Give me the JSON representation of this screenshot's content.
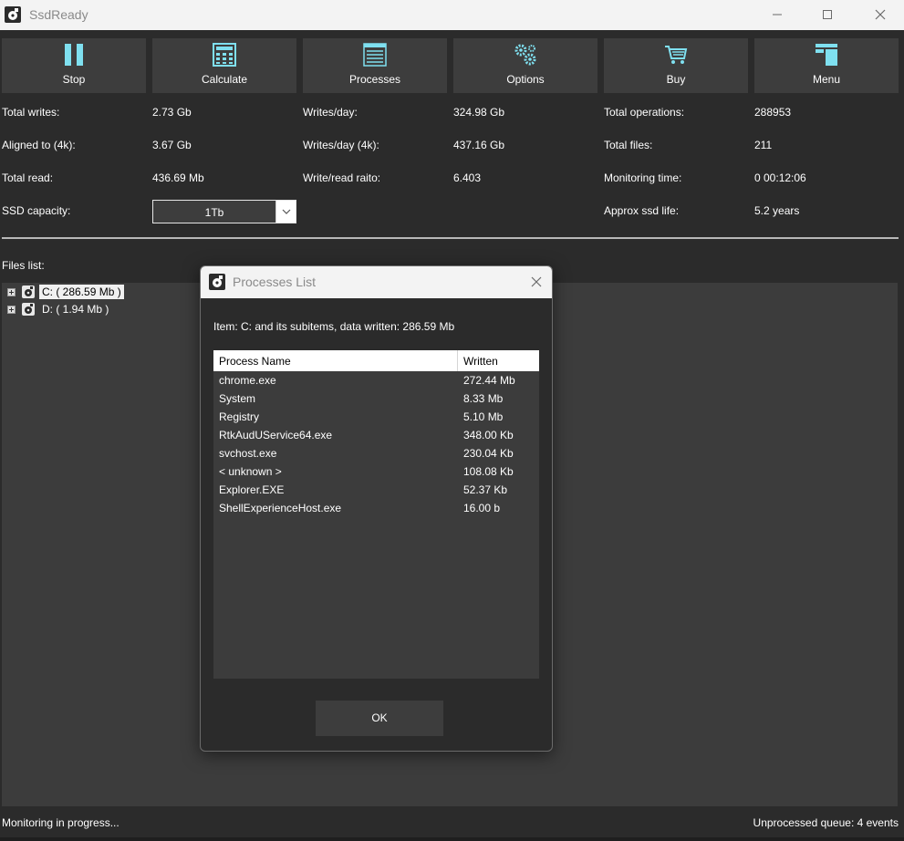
{
  "window": {
    "title": "SsdReady"
  },
  "toolbar": {
    "buttons": [
      {
        "label": "Stop",
        "icon": "pause-icon"
      },
      {
        "label": "Calculate",
        "icon": "calculator-icon"
      },
      {
        "label": "Processes",
        "icon": "list-icon"
      },
      {
        "label": "Options",
        "icon": "gears-icon"
      },
      {
        "label": "Buy",
        "icon": "cart-icon"
      },
      {
        "label": "Menu",
        "icon": "menu-icon"
      }
    ],
    "icon_color": "#7fe0f0"
  },
  "stats": {
    "total_writes_label": "Total writes:",
    "total_writes_value": "2.73 Gb",
    "aligned_label": "Aligned to (4k):",
    "aligned_value": "3.67 Gb",
    "total_read_label": "Total read:",
    "total_read_value": "436.69 Mb",
    "ssd_capacity_label": "SSD capacity:",
    "ssd_capacity_value": "1Tb",
    "writes_day_label": "Writes/day:",
    "writes_day_value": "324.98 Gb",
    "writes_day_4k_label": "Writes/day (4k):",
    "writes_day_4k_value": "437.16 Gb",
    "write_read_label": "Write/read raito:",
    "write_read_value": "6.403",
    "total_ops_label": "Total operations:",
    "total_ops_value": "288953",
    "total_files_label": "Total files:",
    "total_files_value": "211",
    "monitoring_time_label": "Monitoring time:",
    "monitoring_time_value": "0 00:12:06",
    "ssd_life_label": "Approx ssd life:",
    "ssd_life_value": "5.2 years"
  },
  "files": {
    "label": "Files list:",
    "items": [
      {
        "text": "C: ( 286.59 Mb )",
        "selected": true
      },
      {
        "text": "D: ( 1.94 Mb )",
        "selected": false
      }
    ]
  },
  "status": {
    "left": "Monitoring in progress...",
    "right": "Unprocessed queue: 4 events"
  },
  "dialog": {
    "title": "Processes List",
    "info": "Item: C: and its subitems, data written: 286.59 Mb",
    "columns": [
      "Process Name",
      "Written"
    ],
    "rows": [
      {
        "name": "chrome.exe",
        "written": "272.44 Mb"
      },
      {
        "name": "System",
        "written": "8.33 Mb"
      },
      {
        "name": "Registry",
        "written": "5.10 Mb"
      },
      {
        "name": "RtkAudUService64.exe",
        "written": "348.00 Kb"
      },
      {
        "name": "svchost.exe",
        "written": "230.04 Kb"
      },
      {
        "name": "< unknown >",
        "written": "108.08 Kb"
      },
      {
        "name": "Explorer.EXE",
        "written": "52.37 Kb"
      },
      {
        "name": "ShellExperienceHost.exe",
        "written": "16.00 b"
      }
    ],
    "ok_label": "OK"
  }
}
